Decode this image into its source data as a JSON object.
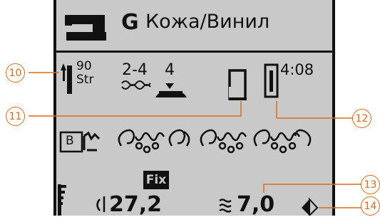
{
  "header": {
    "fabric_group": "G",
    "fabric_name": "Кожа/Винил",
    "machine_icon": "sewing-machine-icon"
  },
  "needle": {
    "size": "90",
    "type": "Str",
    "icon": "needle-icon"
  },
  "thread_tension": {
    "value": "2-4",
    "icon": "thread-tension-icon"
  },
  "presser_foot": {
    "value": "4",
    "icon": "presser-foot-icon"
  },
  "foot_indicator_icon": "presser-foot-indicator-icon",
  "stitch_plate": {
    "code": "4:08",
    "icon": "stitch-plate-icon"
  },
  "stitch_row": {
    "mode_label": "B",
    "mode_icon": "embroidery-mode-icon",
    "pattern_icon": "decorative-stitch-pattern-icon"
  },
  "bottom": {
    "fix_label": "Fix",
    "stitch_length": "27,2",
    "stitch_width": "7,0",
    "stitch_length_icon": "stitch-length-icon",
    "stitch_width_icon": "stitch-width-icon",
    "position_icon": "position-arrows-icon",
    "level_icon": "speed-bars-icon"
  },
  "callouts": [
    "10",
    "11",
    "12",
    "13",
    "14"
  ],
  "colors": {
    "lcd_background": "#c9c9c9",
    "lcd_ink": "#111111",
    "callout": "#e06a16"
  }
}
